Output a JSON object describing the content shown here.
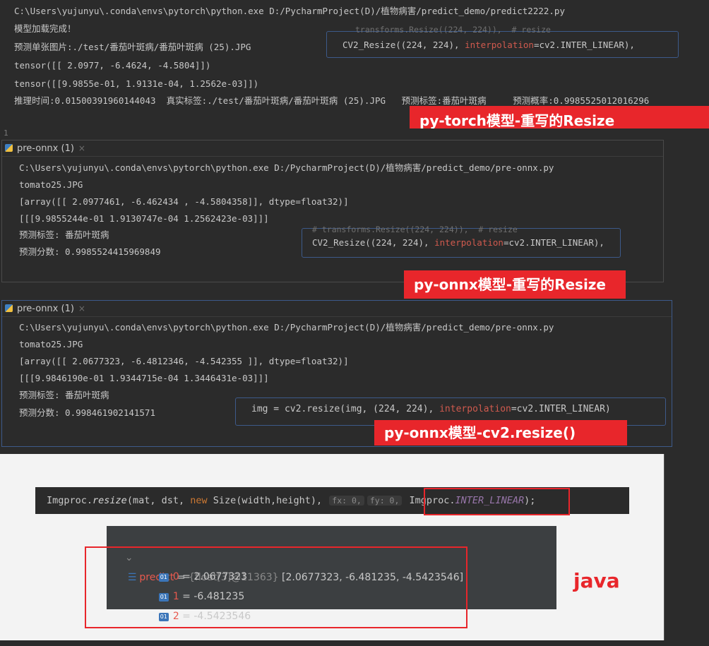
{
  "panel1": {
    "lines": [
      "C:\\Users\\yujunyu\\.conda\\envs\\pytorch\\python.exe D:/PycharmProject(D)/植物病害/predict_demo/predict2222.py",
      "模型加载完成！",
      "预测单张图片:./test/番茄叶斑病/番茄叶斑病 (25).JPG",
      "tensor([[ 2.0977, -6.4624, -4.5804]])",
      "tensor([[9.9855e-01, 1.9131e-04, 1.2562e-03]])",
      "推理时间:0.01500391960144043  真实标签:./test/番茄叶斑病/番茄叶斑病 (25).JPG   预测标签:番茄叶斑病     预测概率:0.9985525012016296"
    ],
    "codebox": {
      "faint": "transforms.Resize((224, 224)),  # resize",
      "fn": "CV2_Resize((224, 224), ",
      "kw": "interpolation",
      "rest": "=cv2.INTER_LINEAR),"
    },
    "label": "py-torch模型-重写的Resize"
  },
  "panel2": {
    "gutter": "1",
    "tab": "pre-onnx (1)",
    "tab_close": "×",
    "lines": [
      "C:\\Users\\yujunyu\\.conda\\envs\\pytorch\\python.exe D:/PycharmProject(D)/植物病害/predict_demo/pre-onnx.py",
      "tomato25.JPG",
      "[array([[ 2.0977461, -6.462434 , -4.5804358]], dtype=float32)]",
      "[[[9.9855244e-01 1.9130747e-04 1.2562423e-03]]]",
      "预测标签: 番茄叶斑病",
      "预测分数: 0.9985524415969849"
    ],
    "codebox": {
      "faint": "# transforms.Resize((224, 224)),  # resize",
      "fn": "CV2_Resize((224, 224), ",
      "kw": "interpolation",
      "rest": "=cv2.INTER_LINEAR),"
    },
    "label": "py-onnx模型-重写的Resize"
  },
  "panel3": {
    "tab": "pre-onnx (1)",
    "tab_close": "×",
    "lines": [
      "C:\\Users\\yujunyu\\.conda\\envs\\pytorch\\python.exe D:/PycharmProject(D)/植物病害/predict_demo/pre-onnx.py",
      "tomato25.JPG",
      "[array([[ 2.0677323, -6.4812346, -4.542355 ]], dtype=float32)]",
      "[[[9.9846190e-01 1.9344715e-04 1.3446431e-03]]]",
      "预测标签: 番茄叶斑病",
      "预测分数: 0.998461902141571"
    ],
    "codebox": {
      "pre": "img = cv2.resize(img, (224, 224), ",
      "kw": "interpolation",
      "rest": "=cv2.INTER_LINEAR)"
    },
    "label": "py-onnx模型-cv2.resize()"
  },
  "java": {
    "code_a": "Imgproc.",
    "code_resize": "resize",
    "code_b": "(mat, dst, ",
    "code_new": "new",
    "code_c": " Size(width,height), ",
    "hint_fx": "fx: 0,",
    "hint_fy": "fy: 0,",
    "code_d": " Imgproc.",
    "code_const": "INTER_LINEAR",
    "code_e": ");",
    "debug": {
      "arrow": "⌄",
      "name": "predict",
      "eq": " = ",
      "type": "{float[3]@11363}",
      "value": " [2.0677323, -6.481235, -4.5423546]",
      "badge": "01",
      "items": [
        {
          "idx": "0",
          "val": "2.0677323"
        },
        {
          "idx": "1",
          "val": "-6.481235"
        },
        {
          "idx": "2",
          "val": "-4.5423546"
        }
      ]
    },
    "label": "java"
  },
  "colors": {
    "background": "#2b2b2b",
    "accent_red": "#e8262b",
    "link_blue": "#3d5a8a"
  }
}
